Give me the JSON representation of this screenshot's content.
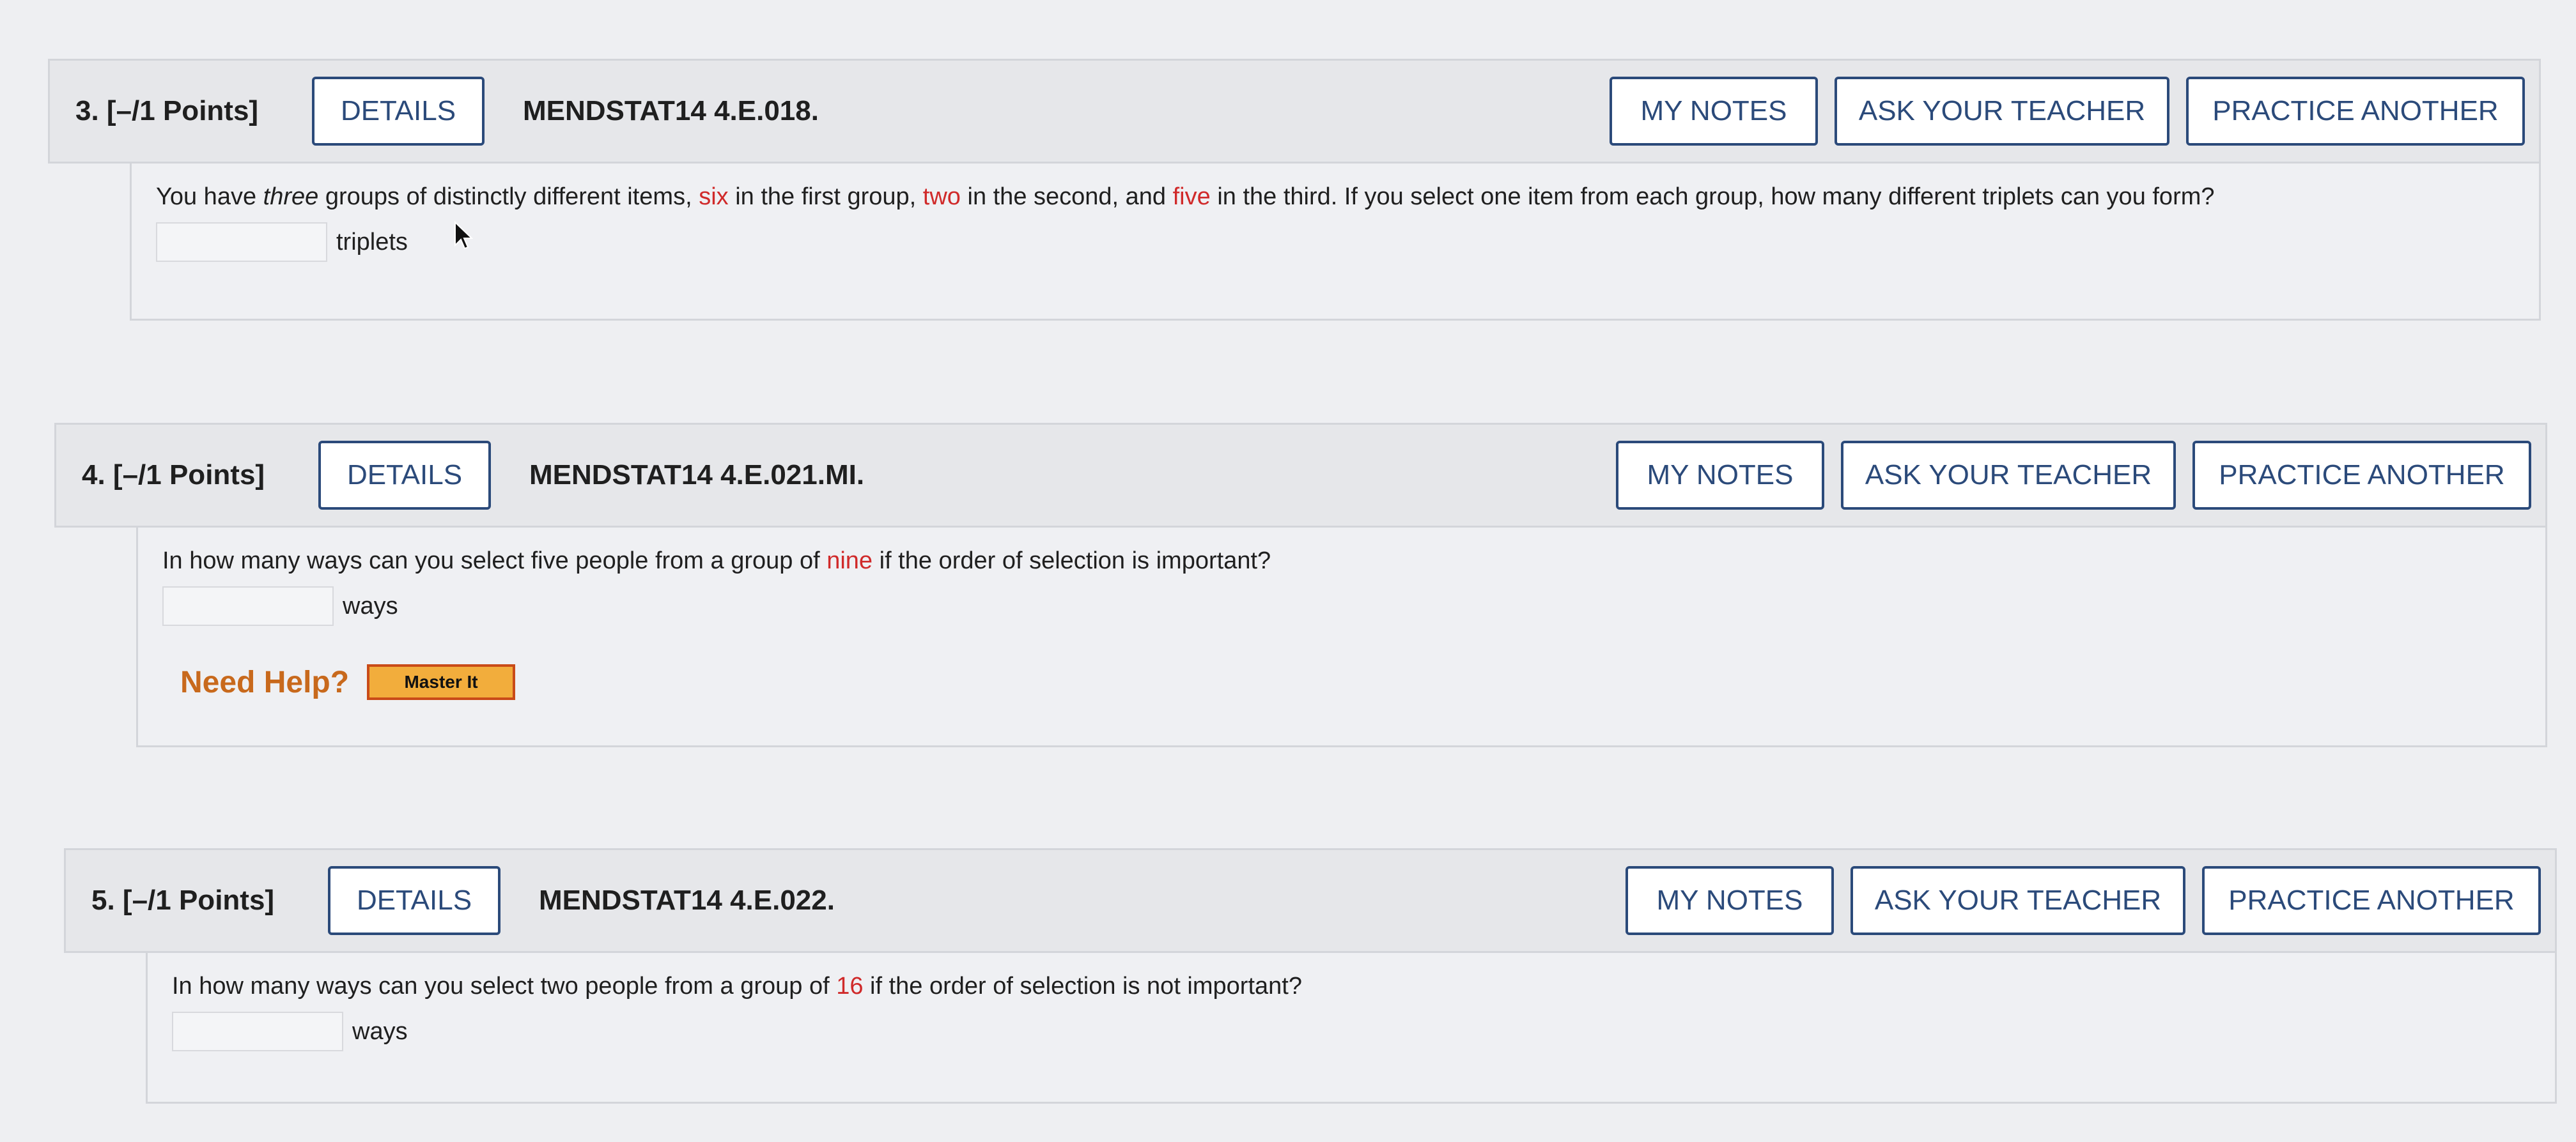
{
  "questions": [
    {
      "number_label": "3.  [–/1 Points]",
      "details_label": "DETAILS",
      "assignment_id": "MENDSTAT14 4.E.018.",
      "my_notes_label": "MY NOTES",
      "ask_teacher_label": "ASK YOUR TEACHER",
      "practice_another_label": "PRACTICE ANOTHER",
      "text_parts": [
        "You have ",
        "three",
        " groups of distinctly different items, ",
        "six",
        " in the first group, ",
        "two",
        " in the second, and ",
        "five",
        " in the third. If you select one item from each group, how many different triplets can you form?"
      ],
      "answer_value": "",
      "unit": "triplets"
    },
    {
      "number_label": "4.  [–/1 Points]",
      "details_label": "DETAILS",
      "assignment_id": "MENDSTAT14 4.E.021.MI.",
      "my_notes_label": "MY NOTES",
      "ask_teacher_label": "ASK YOUR TEACHER",
      "practice_another_label": "PRACTICE ANOTHER",
      "text_parts": [
        "In how many ways can you select five people from a group of ",
        "nine",
        " if the order of selection is important?"
      ],
      "answer_value": "",
      "unit": "ways",
      "need_help_label": "Need Help?",
      "master_it_label": "Master It"
    },
    {
      "number_label": "5.  [–/1 Points]",
      "details_label": "DETAILS",
      "assignment_id": "MENDSTAT14 4.E.022.",
      "my_notes_label": "MY NOTES",
      "ask_teacher_label": "ASK YOUR TEACHER",
      "practice_another_label": "PRACTICE ANOTHER",
      "text_parts": [
        "In how many ways can you select two people from a group of ",
        "16",
        " if the order of selection is not important?"
      ],
      "answer_value": "",
      "unit": "ways"
    }
  ],
  "colors": {
    "button_border": "#2b4a7a",
    "highlight_red": "#d02a2a",
    "need_help_orange": "#c8691c",
    "master_it_fill": "#f2ad3c",
    "master_it_border": "#c94b18"
  },
  "icons": {
    "pointer": "mouse-pointer-icon"
  }
}
